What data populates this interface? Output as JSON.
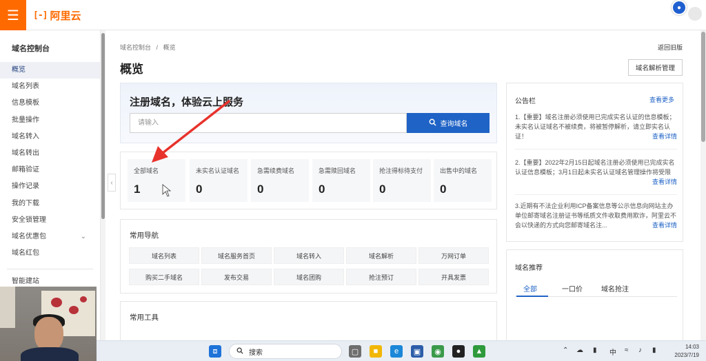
{
  "topbar": {
    "menu_icon": "hamburger-icon",
    "brand_mark": "[-]",
    "brand_name": "阿里云"
  },
  "sidebar": {
    "title": "域名控制台",
    "items": [
      {
        "label": "概览",
        "active": true
      },
      {
        "label": "域名列表"
      },
      {
        "label": "信息模板"
      },
      {
        "label": "批量操作"
      },
      {
        "label": "域名转入"
      },
      {
        "label": "域名转出"
      },
      {
        "label": "邮箱验证"
      },
      {
        "label": "操作记录"
      },
      {
        "label": "我的下载"
      },
      {
        "label": "安全锁管理"
      },
      {
        "label": "域名优惠包",
        "has_chevron": true
      },
      {
        "label": "域名红包"
      }
    ],
    "bottom_item": "智能建站"
  },
  "header": {
    "breadcrumb_root": "域名控制台",
    "breadcrumb_sep": "/",
    "breadcrumb_current": "概览",
    "back_link": "返回旧版",
    "page_title": "概览",
    "dns_button": "域名解析管理"
  },
  "search": {
    "title": "注册域名，体验云上服务",
    "placeholder": "请输入",
    "button_label": "查询域名"
  },
  "stats": [
    {
      "label": "全部域名",
      "value": "1"
    },
    {
      "label": "未实名认证域名",
      "value": "0"
    },
    {
      "label": "急需续费域名",
      "value": "0"
    },
    {
      "label": "急需赎回域名",
      "value": "0"
    },
    {
      "label": "抢注得标待支付",
      "value": "0"
    },
    {
      "label": "出售中的域名",
      "value": "0"
    }
  ],
  "nav": {
    "title": "常用导航",
    "items": [
      "域名列表",
      "域名服务首页",
      "域名转入",
      "域名解析",
      "万网订单",
      "购买二手域名",
      "发布交易",
      "域名团购",
      "抢注预订",
      "开具发票"
    ]
  },
  "tools": {
    "title": "常用工具"
  },
  "notices": {
    "title": "公告栏",
    "more": "查看更多",
    "items": [
      {
        "text": "1.【重要】域名注册必须使用已完成实名认证的信息模板；未实名认证域名不被续费，将被暂停解析，请立即实名认证！",
        "detail": "查看详情"
      },
      {
        "text": "2.【重要】2022年2月15日起域名注册必须使用已完成实名认证信息模板；3月1日起未实名认证域名管理操作将受限",
        "detail": "查看详情"
      },
      {
        "text": "3.近期有不法企业利用ICP备案信息等公示信息向网站主办单位邮寄域名注册证书等纸质文件收取费用欺诈，阿里云不会以快递的方式向您邮寄域名注...",
        "detail": "查看详情"
      }
    ]
  },
  "recommend": {
    "title": "域名推荐",
    "tabs": [
      "全部",
      "一口价",
      "域名抢注"
    ]
  },
  "taskbar": {
    "search_label": "搜索",
    "ime": "中",
    "time": "14:03",
    "date": "2023/7/19"
  }
}
